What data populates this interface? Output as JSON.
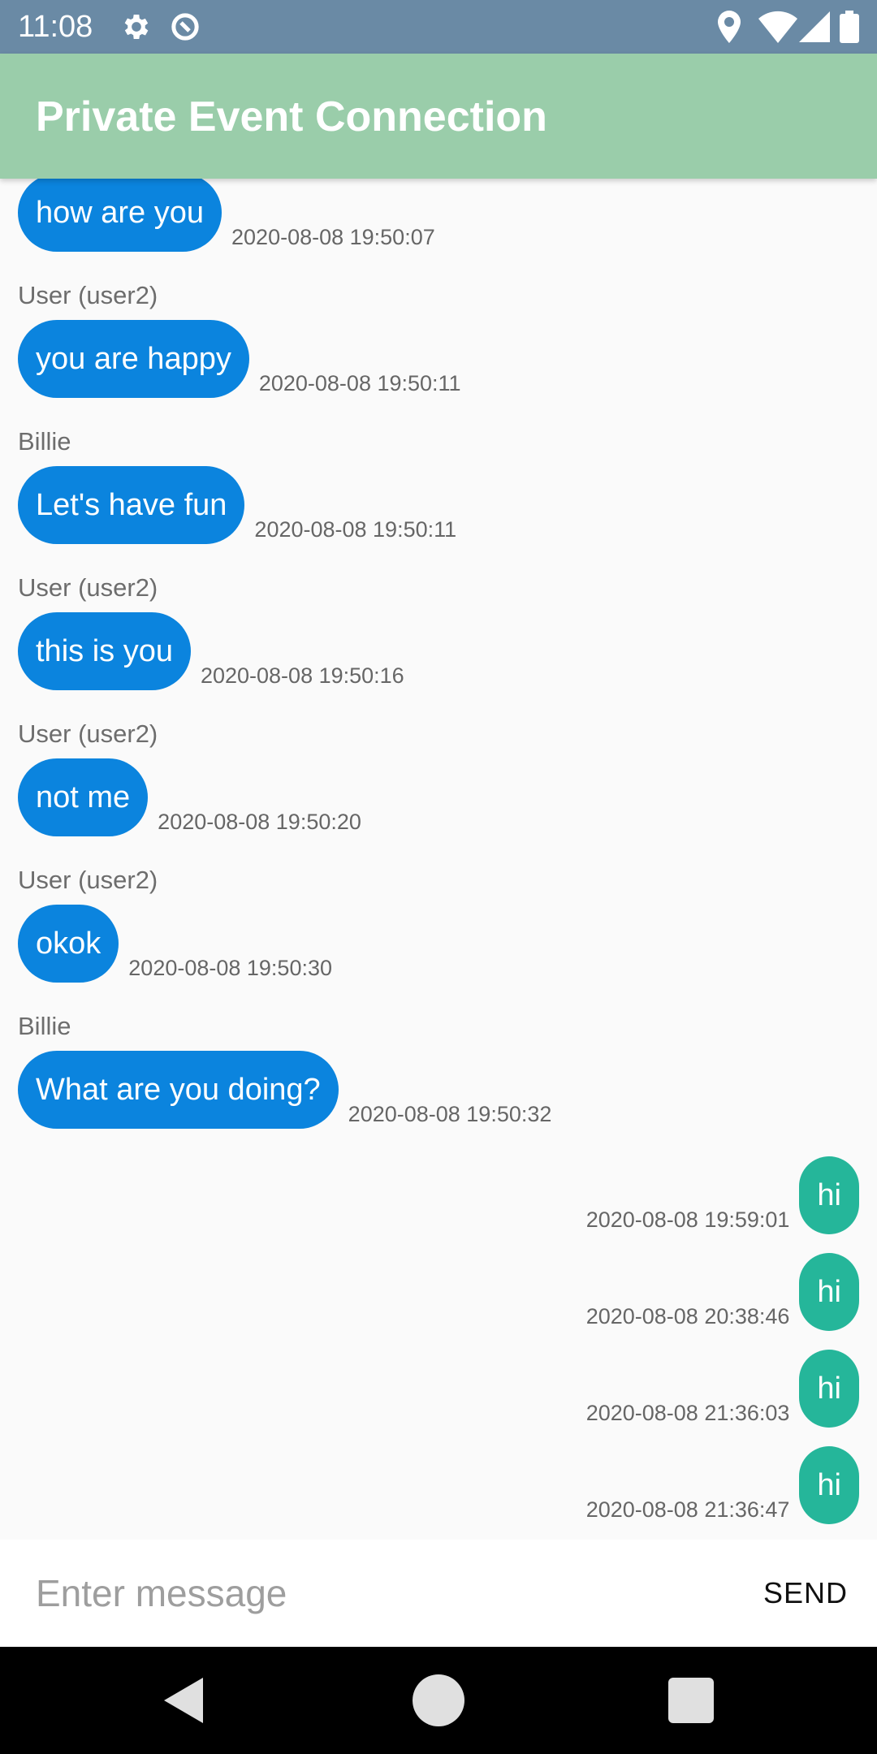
{
  "status_bar": {
    "time": "11:08",
    "icons_left": [
      "gear-icon",
      "data-saver-icon"
    ],
    "icons_right": [
      "location-icon",
      "wifi-icon",
      "signal-icon",
      "battery-icon"
    ]
  },
  "app_bar": {
    "title": "Private Event Connection",
    "color": "#9acdaa"
  },
  "messages": [
    {
      "sender": "",
      "text": "how are you",
      "time": "2020-08-08 19:50:07"
    },
    {
      "sender": "User (user2)",
      "text": "you are happy",
      "time": "2020-08-08 19:50:11"
    },
    {
      "sender": "Billie",
      "text": "Let's have fun",
      "time": "2020-08-08 19:50:11"
    },
    {
      "sender": "User (user2)",
      "text": "this is you",
      "time": "2020-08-08 19:50:16"
    },
    {
      "sender": "User (user2)",
      "text": "not me",
      "time": "2020-08-08 19:50:20"
    },
    {
      "sender": "User (user2)",
      "text": "okok",
      "time": "2020-08-08 19:50:30"
    },
    {
      "sender": "Billie",
      "text": "What are you doing?",
      "time": "2020-08-08 19:50:32"
    }
  ],
  "my_messages": [
    {
      "text": "hi",
      "time": "2020-08-08 19:59:01"
    },
    {
      "text": "hi",
      "time": "2020-08-08 20:38:46"
    },
    {
      "text": "hi",
      "time": "2020-08-08 21:36:03"
    },
    {
      "text": "hi",
      "time": "2020-08-08 21:36:47"
    }
  ],
  "colors": {
    "incoming_bubble": "#0b84de",
    "outgoing_bubble": "#25b69a",
    "status_bar": "#6a8aa5"
  },
  "composer": {
    "placeholder": "Enter message",
    "value": "",
    "send_label": "SEND"
  },
  "nav_bar": {
    "icons": [
      "back-icon",
      "home-icon",
      "recents-icon"
    ]
  }
}
